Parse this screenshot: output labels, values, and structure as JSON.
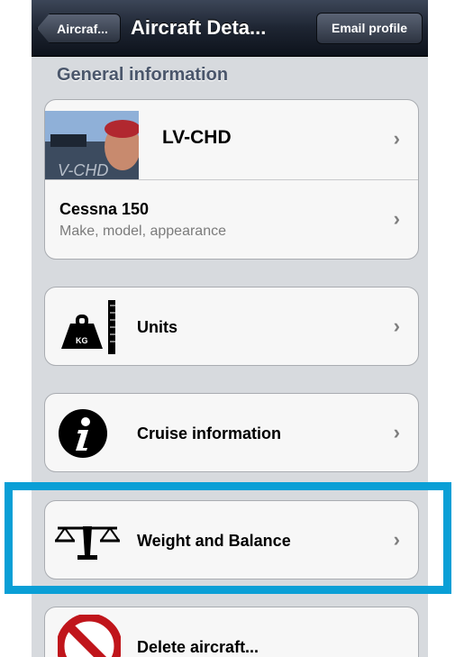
{
  "nav": {
    "back_label": "Aircraf...",
    "title": "Aircraft Deta...",
    "right_button": "Email profile"
  },
  "section": {
    "header": "General information"
  },
  "aircraft": {
    "registration": "LV-CHD",
    "thumb_overlay_text": "V-CHD",
    "model": "Cessna 150",
    "model_subtitle": "Make, model, appearance"
  },
  "menu": {
    "units": "Units",
    "cruise": "Cruise information",
    "weight_balance": "Weight and Balance",
    "delete": "Delete aircraft..."
  },
  "icons": {
    "units": "weight-ruler-icon",
    "cruise": "info-icon",
    "weight_balance": "scale-icon",
    "delete": "no-entry-icon",
    "kg_text": "KG"
  },
  "colors": {
    "highlight": "#0a9fd6",
    "section_header": "#4a566b"
  }
}
